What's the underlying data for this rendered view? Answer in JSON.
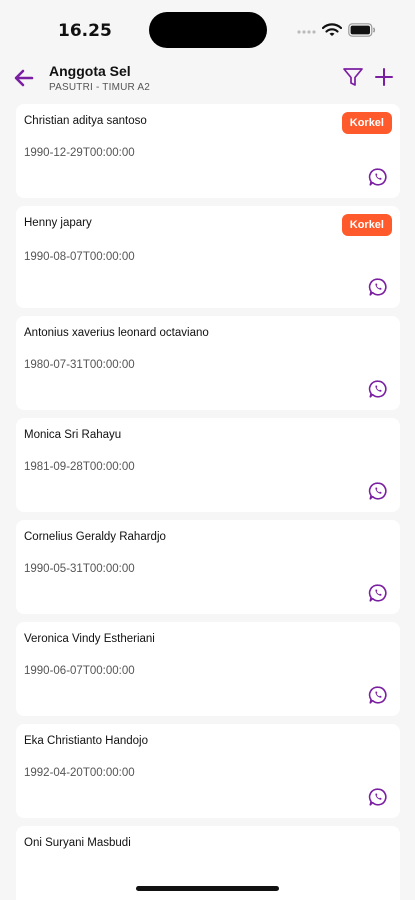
{
  "status_bar": {
    "time": "16.25"
  },
  "header": {
    "title": "Anggota Sel",
    "subtitle": "PASUTRI - TIMUR A2"
  },
  "colors": {
    "accent": "#7b1fa2",
    "badge": "#ff5a2c",
    "background": "#f6f6f6",
    "card": "#ffffff"
  },
  "icons": {
    "back": "arrow-left-icon",
    "filter": "filter-icon",
    "add": "plus-icon",
    "contact": "whatsapp-icon"
  },
  "members": [
    {
      "name": "Christian aditya santoso",
      "date": "1990-12-29T00:00:00",
      "badge": "Korkel"
    },
    {
      "name": "Henny japary",
      "date": "1990-08-07T00:00:00",
      "badge": "Korkel"
    },
    {
      "name": "Antonius xaverius leonard octaviano",
      "date": "1980-07-31T00:00:00"
    },
    {
      "name": "Monica Sri Rahayu",
      "date": "1981-09-28T00:00:00"
    },
    {
      "name": "Cornelius Geraldy Rahardjo",
      "date": "1990-05-31T00:00:00"
    },
    {
      "name": "Veronica Vindy Estheriani",
      "date": "1990-06-07T00:00:00"
    },
    {
      "name": "Eka Christianto Handojo",
      "date": "1992-04-20T00:00:00"
    },
    {
      "name": "Oni Suryani Masbudi"
    }
  ]
}
